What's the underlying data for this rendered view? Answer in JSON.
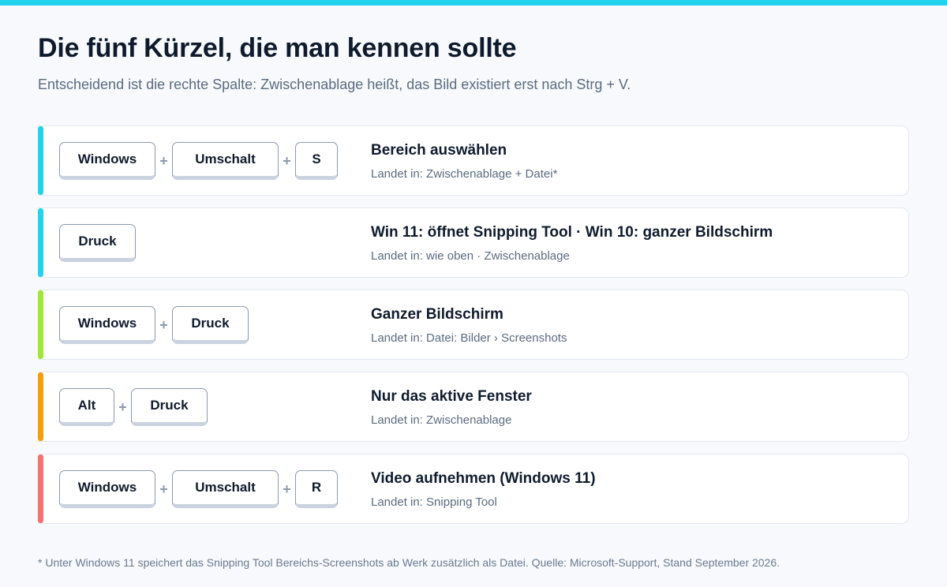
{
  "colors": {
    "top_bar": "#22d3ee",
    "accent_cyan": "#22d3ee",
    "accent_lime": "#a3e635",
    "accent_amber": "#f59e0b",
    "accent_coral": "#f87171"
  },
  "header": {
    "title": "Die fünf Kürzel, die man kennen sollte",
    "subtitle": "Entscheidend ist die rechte Spalte: Zwischenablage heißt, das Bild existiert erst nach Strg + V."
  },
  "plus_sign": "+",
  "shortcuts": [
    {
      "keys": [
        "Windows",
        "Umschalt",
        "S"
      ],
      "action": "Bereich auswählen",
      "destination": "Landet in: Zwischenablage + Datei*",
      "accent": "#22d3ee"
    },
    {
      "keys": [
        "Druck"
      ],
      "action": "Win 11: öffnet Snipping Tool · Win 10: ganzer Bildschirm",
      "destination": "Landet in: wie oben · Zwischenablage",
      "accent": "#22d3ee"
    },
    {
      "keys": [
        "Windows",
        "Druck"
      ],
      "action": "Ganzer Bildschirm",
      "destination": "Landet in: Datei: Bilder › Screenshots",
      "accent": "#a3e635"
    },
    {
      "keys": [
        "Alt",
        "Druck"
      ],
      "action": "Nur das aktive Fenster",
      "destination": "Landet in: Zwischenablage",
      "accent": "#f59e0b"
    },
    {
      "keys": [
        "Windows",
        "Umschalt",
        "R"
      ],
      "action": "Video aufnehmen (Windows 11)",
      "destination": "Landet in: Snipping Tool",
      "accent": "#f87171"
    }
  ],
  "footnote": "* Unter Windows 11 speichert das Snipping Tool Bereichs-Screenshots ab Werk zusätzlich als Datei. Quelle: Microsoft-Support, Stand September 2026."
}
